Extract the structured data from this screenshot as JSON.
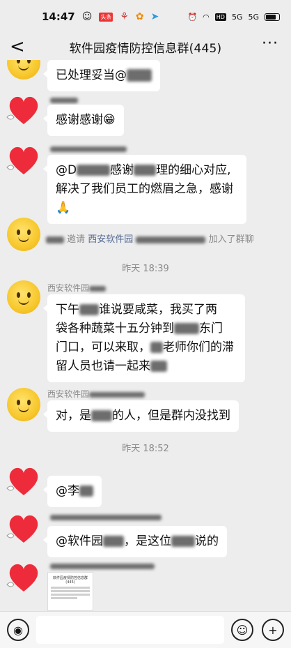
{
  "status": {
    "time": "14:47",
    "signal_1": "5G",
    "signal_2": "5G"
  },
  "header": {
    "back_label": "<",
    "title": "软件园疫情防控信息群(445)",
    "more_label": "···"
  },
  "messages": [
    {
      "text": "已处理妥当@"
    },
    {
      "text": "感谢感谢😁"
    },
    {
      "line1_a": "@D",
      "line1_b": "感谢",
      "line1_c": "理的细心对应,",
      "line2": "解决了我们员工的燃眉之急，感谢",
      "line3": "🙏"
    },
    {
      "line1_a": "下午",
      "line1_b": "谁说要咸菜，我买了两",
      "line2_a": "袋各种蔬菜十五分钟到",
      "line2_b": "东门",
      "line3_a": "门口，可以来取，",
      "line3_b": "老师你们的滞",
      "line4": "留人员也请一起来"
    },
    {
      "text_a": "对，是",
      "text_b": "的人，但是群内没找到"
    },
    {
      "text": "@李"
    },
    {
      "text_a": "@软件园",
      "text_b": "，是这位",
      "text_c": "说的"
    }
  ],
  "system": {
    "invite_prefix": "邀请",
    "invite_link": "西安软件园",
    "invite_suffix": "加入了群聊"
  },
  "senders": {
    "s1": "西安软件园",
    "s2": "西安软件园"
  },
  "times": {
    "t1": "昨天 18:39",
    "t2": "昨天 18:52"
  },
  "thumbnail": {
    "title": "软件园疫情防控信息群(445)"
  },
  "input": {
    "value": ""
  }
}
